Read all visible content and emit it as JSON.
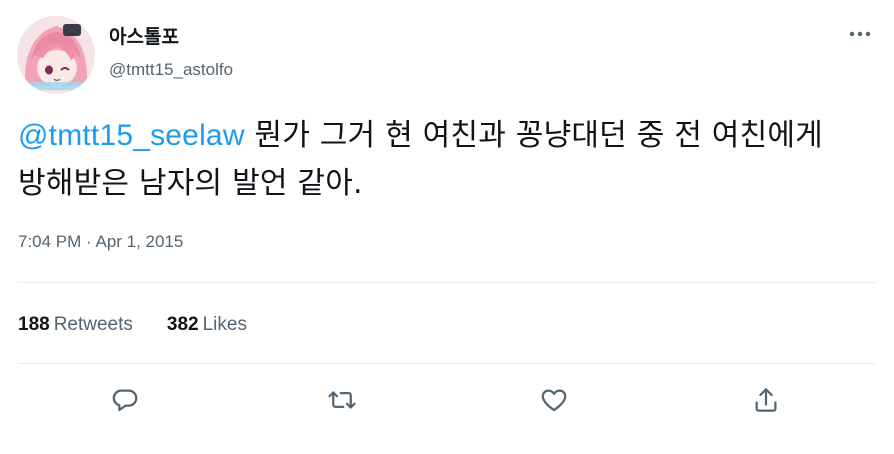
{
  "author": {
    "display_name": "아스톨포",
    "handle": "@tmtt15_astolfo"
  },
  "tweet": {
    "mention": "@tmtt15_seelaw",
    "text": " 뭔가 그거 현 여친과 꽁냥대던 중 전 여친에게 방해받은 남자의 발언 같아.",
    "timestamp": "7:04 PM · Apr 1, 2015"
  },
  "stats": {
    "retweets_count": "188",
    "retweets_label": "Retweets",
    "likes_count": "382",
    "likes_label": "Likes"
  },
  "icons": {
    "more": "more-horizontal-icon",
    "reply": "reply-icon",
    "retweet": "retweet-icon",
    "like": "heart-icon",
    "share": "share-icon"
  },
  "colors": {
    "accent": "#1d9bf0",
    "text": "#0f1419",
    "secondary": "#536471",
    "divider": "#e6ecf0"
  }
}
